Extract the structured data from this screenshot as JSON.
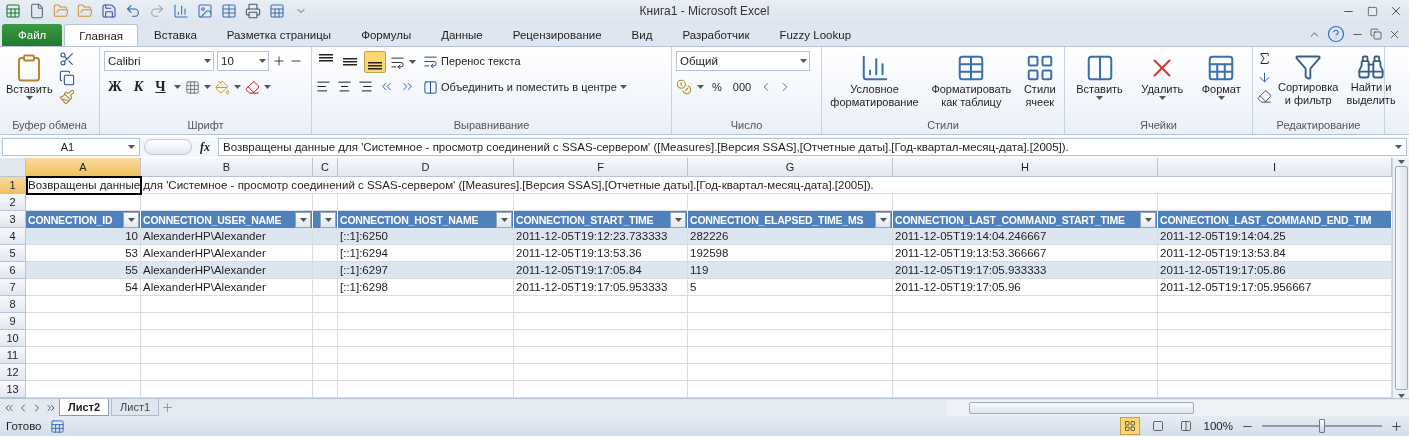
{
  "window": {
    "title": "Книга1  -  Microsoft Excel"
  },
  "tabs": [
    {
      "label": "Файл",
      "kind": "file",
      "selected": false
    },
    {
      "label": "Главная",
      "kind": "tab",
      "selected": true
    },
    {
      "label": "Вставка",
      "kind": "tab",
      "selected": false
    },
    {
      "label": "Разметка страницы",
      "kind": "tab",
      "selected": false
    },
    {
      "label": "Формулы",
      "kind": "tab",
      "selected": false
    },
    {
      "label": "Данные",
      "kind": "tab",
      "selected": false
    },
    {
      "label": "Рецензирование",
      "kind": "tab",
      "selected": false
    },
    {
      "label": "Вид",
      "kind": "tab",
      "selected": false
    },
    {
      "label": "Разработчик",
      "kind": "tab",
      "selected": false
    },
    {
      "label": "Fuzzy Lookup",
      "kind": "tab",
      "selected": false
    }
  ],
  "ribbon": {
    "clipboard": {
      "paste": "Вставить",
      "label": "Буфер обмена"
    },
    "font": {
      "name": "Calibri",
      "size": "10",
      "bold": "Ж",
      "italic": "К",
      "underline": "Ч",
      "label": "Шрифт"
    },
    "alignment": {
      "vertical": [
        {
          "selected": false
        },
        {
          "selected": false
        },
        {
          "selected": true
        }
      ],
      "wrap": "Перенос текста",
      "merge": "Объединить и поместить в центре",
      "label": "Выравнивание"
    },
    "number": {
      "format": "Общий",
      "percent": "%",
      "thousands": "000",
      "label": "Число"
    },
    "styles": {
      "buttons": [
        {
          "kind": "conditional",
          "lines": [
            "Условное",
            "форматирование"
          ]
        },
        {
          "kind": "table",
          "lines": [
            "Форматировать",
            "как таблицу"
          ]
        },
        {
          "kind": "cellstyle",
          "lines": [
            "Стили",
            "ячеек"
          ]
        }
      ],
      "label": "Стили"
    },
    "cells": {
      "buttons": [
        {
          "kind": "insert",
          "label": "Вставить"
        },
        {
          "kind": "delete",
          "label": "Удалить"
        },
        {
          "kind": "format",
          "label": "Формат"
        }
      ],
      "label": "Ячейки"
    },
    "editing": {
      "buttons": [
        {
          "kind": "sort",
          "lines": [
            "Сортировка",
            "и фильтр"
          ]
        },
        {
          "kind": "find",
          "lines": [
            "Найти и",
            "выделить"
          ]
        }
      ],
      "label": "Редактирование"
    }
  },
  "formula_bar": {
    "cell": "A1",
    "fx": "fx",
    "value": "Возвращены данные для 'Системное - просмотр соединений с SSAS-сервером' ([Measures].[Версия SSAS],[Отчетные даты].[Год-квартал-месяц-дата].[2005])."
  },
  "sheet": {
    "columns": [
      {
        "label": "A",
        "selected": true
      },
      {
        "label": "B",
        "selected": false
      },
      {
        "label": "C",
        "selected": false
      },
      {
        "label": "D",
        "selected": false
      },
      {
        "label": "F",
        "selected": false
      },
      {
        "label": "G",
        "selected": false
      },
      {
        "label": "H",
        "selected": false
      },
      {
        "label": "I",
        "selected": false
      }
    ],
    "rows": [
      {
        "label": "1",
        "selected": true
      },
      {
        "label": "2",
        "selected": false
      },
      {
        "label": "3",
        "selected": false
      },
      {
        "label": "4",
        "selected": false
      },
      {
        "label": "5",
        "selected": false
      },
      {
        "label": "6",
        "selected": false
      },
      {
        "label": "7",
        "selected": false
      },
      {
        "label": "8",
        "selected": false
      },
      {
        "label": "9",
        "selected": false
      },
      {
        "label": "10",
        "selected": false
      },
      {
        "label": "11",
        "selected": false
      },
      {
        "label": "12",
        "selected": false
      },
      {
        "label": "13",
        "selected": false
      }
    ],
    "note": "Возвращены данные для 'Системное - просмотр соединений с SSAS-сервером' ([Measures].[Версия SSAS],[Отчетные даты].[Год-квартал-месяц-дата].[2005]).",
    "table": {
      "headers": [
        {
          "kind": "full",
          "label": "CONNECTION_ID"
        },
        {
          "kind": "full",
          "label": "CONNECTION_USER_NAME"
        },
        {
          "kind": "narrow"
        },
        {
          "kind": "full",
          "label": "CONNECTION_HOST_NAME"
        },
        {
          "kind": "full",
          "label": "CONNECTION_START_TIME"
        },
        {
          "kind": "full",
          "label": "CONNECTION_ELAPSED_TIME_MS"
        },
        {
          "kind": "full",
          "label": "CONNECTION_LAST_COMMAND_START_TIME"
        },
        {
          "kind": "cut",
          "label": "CONNECTION_LAST_COMMAND_END_TIM"
        }
      ],
      "rows": [
        {
          "banded": true,
          "cells": [
            "10",
            "AlexanderHP\\Alexander",
            "[::1]:6250",
            "2011-12-05T19:12:23.733333",
            "282226",
            "2011-12-05T19:14:04.246667",
            "2011-12-05T19:14:04.25"
          ]
        },
        {
          "banded": false,
          "cells": [
            "53",
            "AlexanderHP\\Alexander",
            "[::1]:6294",
            "2011-12-05T19:13:53.36",
            "192598",
            "2011-12-05T19:13:53.366667",
            "2011-12-05T19:13:53.84"
          ]
        },
        {
          "banded": true,
          "cells": [
            "55",
            "AlexanderHP\\Alexander",
            "[::1]:6297",
            "2011-12-05T19:17:05.84",
            "119",
            "2011-12-05T19:17:05.933333",
            "2011-12-05T19:17:05.86"
          ]
        },
        {
          "banded": false,
          "cells": [
            "54",
            "AlexanderHP\\Alexander",
            "[::1]:6298",
            "2011-12-05T19:17:05.953333",
            "5",
            "2011-12-05T19:17:05.96",
            "2011-12-05T19:17:05.956667"
          ]
        }
      ]
    }
  },
  "sheet_tabs": [
    {
      "label": "Лист2",
      "selected": true
    },
    {
      "label": "Лист1",
      "selected": false
    }
  ],
  "status_bar": {
    "status": "Готово",
    "views": [
      {
        "selected": true
      },
      {
        "selected": false
      },
      {
        "selected": false
      }
    ],
    "zoom": "100%",
    "zoom_slider": {
      "level": 0.5
    }
  }
}
